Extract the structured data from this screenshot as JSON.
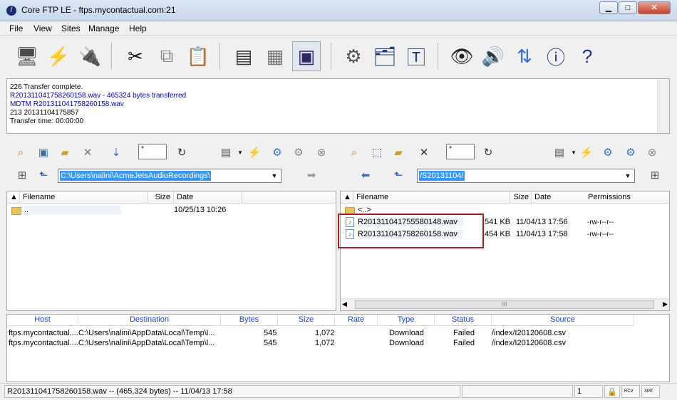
{
  "window": {
    "title": "Core FTP LE - ftps.mycontactual.com:21",
    "min": "▁",
    "max": "□",
    "close": "✕"
  },
  "menu": [
    "File",
    "View",
    "Sites",
    "Manage",
    "Help"
  ],
  "toolbar": [
    {
      "name": "site-manager-icon",
      "glyph": "🖥"
    },
    {
      "name": "quick-connect-icon",
      "glyph": "⚡"
    },
    {
      "name": "disconnect-icon",
      "glyph": "🔌"
    },
    {
      "name": "cut-icon",
      "glyph": "✂"
    },
    {
      "name": "copy-icon",
      "glyph": "⧉"
    },
    {
      "name": "paste-icon",
      "glyph": "📋"
    },
    {
      "name": "view-list-icon",
      "glyph": "▤"
    },
    {
      "name": "view-details-icon",
      "glyph": "▦"
    },
    {
      "name": "view-thumbnails-icon",
      "glyph": "▣"
    },
    {
      "name": "settings-gear-icon",
      "glyph": "⚙"
    },
    {
      "name": "site-properties-icon",
      "glyph": "🗂"
    },
    {
      "name": "text-editor-icon",
      "glyph": "🅃"
    },
    {
      "name": "view-eye-icon",
      "glyph": "👁"
    },
    {
      "name": "sound-icon",
      "glyph": "🔊"
    },
    {
      "name": "sync-arrows-icon",
      "glyph": "⇅"
    },
    {
      "name": "about-logo-icon",
      "glyph": "ⓘ"
    },
    {
      "name": "help-question-icon",
      "glyph": "?"
    }
  ],
  "log": [
    {
      "text": "226 Transfer complete.",
      "blue": false
    },
    {
      "text": "R201311041758260158.wav - 465324 bytes transferred",
      "blue": true
    },
    {
      "text": "MDTM R201311041758260158.wav",
      "blue": true
    },
    {
      "text": "213 20131104175857",
      "blue": false
    },
    {
      "text": "Transfer time: 00:00:00",
      "blue": false
    }
  ],
  "left_pane": {
    "filter": "*",
    "path": "C:\\Users\\nalini\\AcmeJetsAudioRecordings\\",
    "headers": {
      "filename": "Filename",
      "size": "Size",
      "date": "Date"
    },
    "rows": [
      {
        "name": "..",
        "size": "",
        "date": "10/25/13  10:26"
      }
    ]
  },
  "right_pane": {
    "filter": "*",
    "path": "/S20131104/",
    "headers": {
      "filename": "Filename",
      "size": "Size",
      "date": "Date",
      "permissions": "Permissions"
    },
    "rows": [
      {
        "name": "<..>",
        "size": "",
        "date": "",
        "perm": "",
        "type": "folder"
      },
      {
        "name": "R201311041755580148.wav",
        "size": "541 KB",
        "date": "11/04/13  17:56",
        "perm": "-rw-r--r--",
        "type": "file"
      },
      {
        "name": "R201311041758260158.wav",
        "size": "454 KB",
        "date": "11/04/13  17:58",
        "perm": "-rw-r--r--",
        "type": "file"
      }
    ],
    "scroll_thumb": "III"
  },
  "queue": {
    "headers": [
      "Host",
      "Destination",
      "Bytes",
      "Size",
      "Rate",
      "Type",
      "Status",
      "Source"
    ],
    "rows": [
      {
        "host": "ftps.mycontactual....",
        "dest": "C:\\Users\\nalini\\AppData\\Local\\Temp\\l...",
        "bytes": "545",
        "size": "1,072",
        "rate": "",
        "type": "Download",
        "status": "Failed",
        "source": "/index/I20120608.csv"
      },
      {
        "host": "ftps.mycontactual....",
        "dest": "C:\\Users\\nalini\\AppData\\Local\\Temp\\l...",
        "bytes": "545",
        "size": "1,072",
        "rate": "",
        "type": "Download",
        "status": "Failed",
        "source": "/index/I20120608.csv"
      }
    ]
  },
  "status": {
    "message": "R201311041758260158.wav -- (465,324 bytes) -- 11/04/13  17:58",
    "count": "1",
    "rcv": "RCV",
    "xmt": "XMT"
  }
}
